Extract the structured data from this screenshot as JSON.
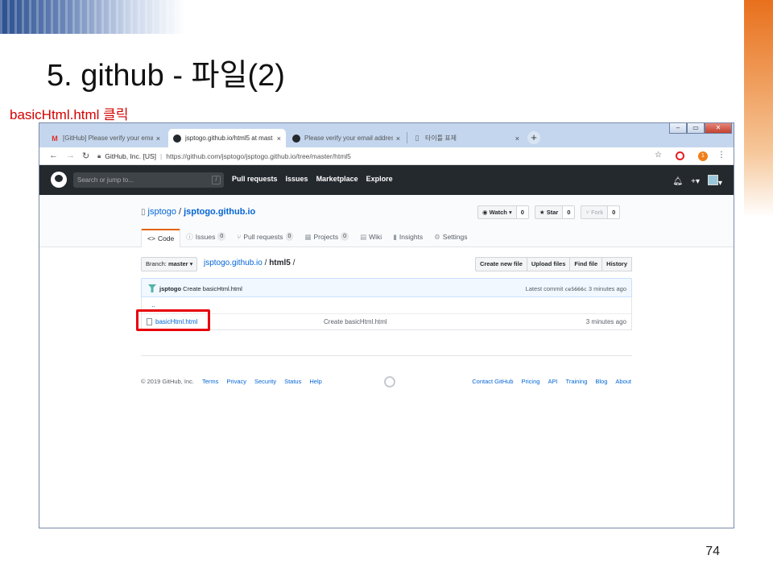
{
  "slide": {
    "title": "5. github - 파일(2)",
    "instruction": "basicHtml.html   클릭",
    "page_number": "74"
  },
  "browser": {
    "tabs": [
      {
        "icon": "gmail-icon",
        "label": "[GitHub] Please verify your ema",
        "close": "×"
      },
      {
        "icon": "github-icon",
        "label": "jsptogo.github.io/html5 at mast",
        "close": "×",
        "active": true
      },
      {
        "icon": "github-icon",
        "label": "Please verify your email address",
        "close": "×"
      },
      {
        "icon": "page-icon",
        "label": "타이틀 표제",
        "close": "×"
      }
    ],
    "new_tab": "+",
    "window_controls": [
      "‒",
      "▭",
      "✕"
    ],
    "address": {
      "site_identity": "GitHub, Inc. [US]",
      "url": "https://github.com/jsptogo/jsptogo.github.io/tree/master/html5",
      "extension_badge": "1"
    }
  },
  "github": {
    "search_placeholder": "Search or jump to...",
    "search_shortcut": "/",
    "nav": [
      "Pull requests",
      "Issues",
      "Marketplace",
      "Explore"
    ],
    "owner": "jsptogo",
    "repo": "jsptogo.github.io",
    "actions": {
      "watch": "Watch ▾",
      "watch_count": "0",
      "star": "Star",
      "star_count": "0",
      "fork": "Fork",
      "fork_count": "0"
    },
    "tabs": [
      {
        "icon": "<>",
        "label": "Code"
      },
      {
        "icon": "ⓘ",
        "label": "Issues",
        "count": "0"
      },
      {
        "icon": "⑂",
        "label": "Pull requests",
        "count": "0"
      },
      {
        "icon": "▦",
        "label": "Projects",
        "count": "0"
      },
      {
        "icon": "▤",
        "label": "Wiki"
      },
      {
        "icon": "▮",
        "label": "Insights"
      },
      {
        "icon": "⚙",
        "label": "Settings"
      }
    ],
    "branch_label": "Branch:",
    "branch": "master ▾",
    "breadcrumb_repo": "jsptogo.github.io",
    "breadcrumb_sep": "/",
    "breadcrumb_dir": "html5",
    "breadcrumb_trail": "/",
    "file_actions": [
      "Create new file",
      "Upload files",
      "Find file",
      "History"
    ],
    "commit": {
      "author": "jsptogo",
      "message": "Create basicHtml.html",
      "latest_label": "Latest commit",
      "sha": "ce5666c",
      "age": "3 minutes ago"
    },
    "parent_dir": "..",
    "files": [
      {
        "name": "basicHtml.html",
        "message": "Create basicHtml.html",
        "age": "3 minutes ago"
      }
    ],
    "footer_left": [
      "© 2019 GitHub, Inc.",
      "Terms",
      "Privacy",
      "Security",
      "Status",
      "Help"
    ],
    "footer_right": [
      "Contact GitHub",
      "Pricing",
      "API",
      "Training",
      "Blog",
      "About"
    ]
  }
}
